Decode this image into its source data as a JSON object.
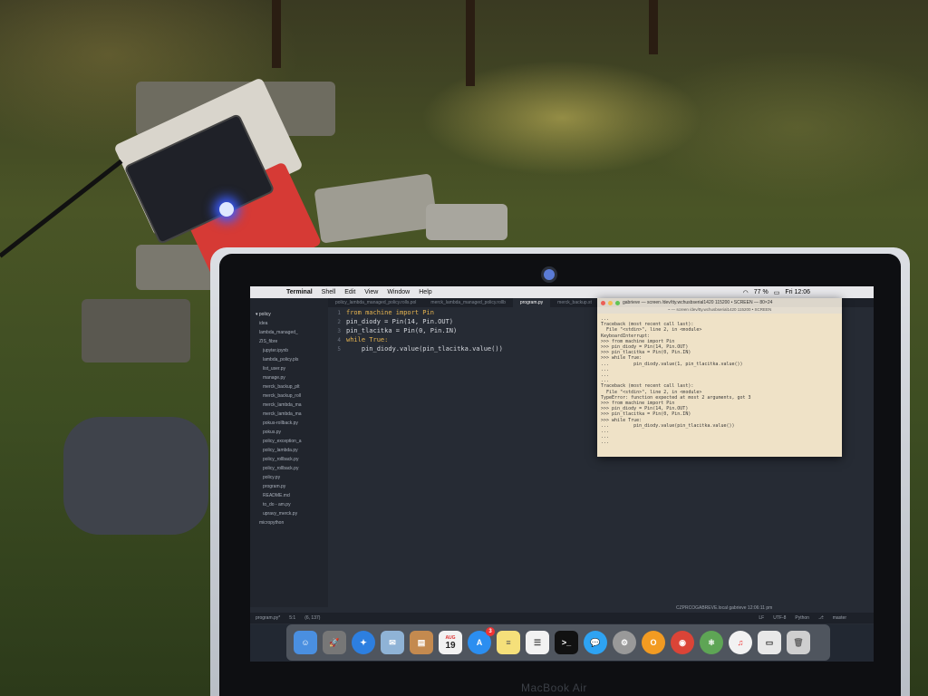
{
  "menubar": {
    "app": "Terminal",
    "items": [
      "Shell",
      "Edit",
      "View",
      "Window",
      "Help"
    ],
    "battery": "77 %",
    "clock": "Fri 12:06"
  },
  "editor": {
    "tabs": [
      "policy_lambda_managed_policy.rolls.pol",
      "merck_lambda_managed_policy.rollb",
      "program.py",
      "merck_backup.st"
    ],
    "active_tab": "program.py",
    "project_root": "policy",
    "sidebar_items": [
      "idea",
      "lambda_managed_",
      "ZIS_fibre",
      "jupyter.ipynb",
      "lambda_policy.pls",
      "list_user.py",
      "manage.py",
      "merck_backup_plt",
      "merck_backup_roll",
      "merck_lambda_ma",
      "merck_lambda_ma",
      "pokus-rollback.py",
      "pokus.py",
      "policy_exception_a",
      "policy_lambda.py",
      "policy_rollback.py",
      "policy_rollback.py",
      "policy.py",
      "program.py",
      "README.md",
      "to_do - am.py",
      "upravy_merck.py",
      "micropython"
    ],
    "code": [
      {
        "n": "1",
        "text": "from machine import Pin"
      },
      {
        "n": "2",
        "text": "pin_diody = Pin(14, Pin.OUT)"
      },
      {
        "n": "3",
        "text": "pin_tlacitka = Pin(0, Pin.IN)"
      },
      {
        "n": "4",
        "text": "while True:"
      },
      {
        "n": "5",
        "text": "    pin_diody.value(pin_tlacitka.value())"
      }
    ]
  },
  "terminal": {
    "title": "gabrieve — screen /dev/tty.wchusbserial1420 115200 • SCREEN — 80×24",
    "subtitle": "~ — screen /dev/tty.wchusbserial1420 115200 • SCREEN",
    "body": "...\nTraceback (most recent call last):\n  File \"<stdin>\", line 2, in <module>\nKeyboardInterrupt:\n>>> from machine import Pin\n>>> pin_diody = Pin(14, Pin.OUT)\n>>> pin_tlacitka = Pin(0, Pin.IN)\n>>> while True:\n...         pin_diody.value(1, pin_tlacitka.value())\n...\n...\n...\nTraceback (most recent call last):\n  File \"<stdin>\", line 2, in <module>\nTypeError: function expected at most 2 arguments, got 3\n>>> from machine import Pin\n>>> pin_diody = Pin(14, Pin.OUT)\n>>> pin_tlacitka = Pin(0, Pin.IN)\n>>> while True:\n...         pin_diody.value(pin_tlacitka.value())\n...\n...\n..."
  },
  "statusbar": {
    "file": "program.py*",
    "position": "5:1",
    "selection": "(6, 137)",
    "line_ending": "LF",
    "encoding": "UTF-8",
    "grammar": "Python",
    "branch": "master",
    "host": "CZPRCOGABREVE.local gabrieve 12:06:11 pm"
  },
  "dock": {
    "calendar_month": "AUG",
    "calendar_day": "19",
    "appstore_badge": "3"
  },
  "laptop": {
    "brand": "MacBook Air"
  }
}
